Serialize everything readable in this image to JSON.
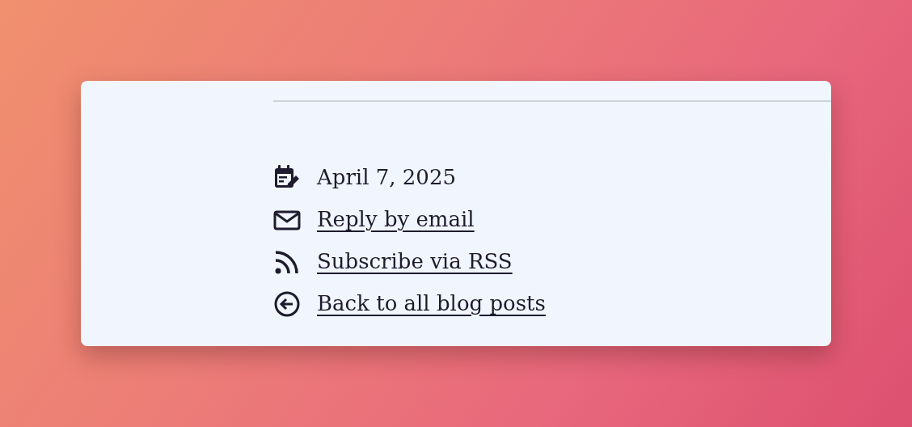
{
  "post_meta": [
    {
      "kind": "date",
      "text": "April 7, 2025"
    },
    {
      "kind": "email",
      "text": "Reply by email"
    },
    {
      "kind": "rss",
      "text": "Subscribe via RSS"
    },
    {
      "kind": "back",
      "text": "Back to all blog posts"
    }
  ]
}
